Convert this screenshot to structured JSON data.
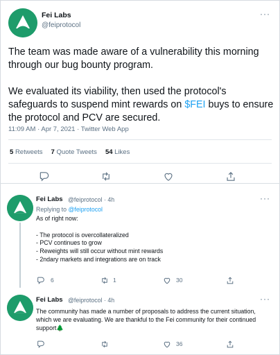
{
  "tweet": {
    "author_name": "Fei Labs",
    "author_handle": "@feiprotocol",
    "more_label": "···",
    "paragraph1": "The team was made aware of a vulnerability this morning through our bug bounty program.",
    "paragraph2_before": "We evaluated its viability, then used the protocol's safeguards to suspend mint rewards on ",
    "paragraph2_cashtag": "$FEI",
    "paragraph2_after": " buys to ensure the protocol and PCV are secured.",
    "timestamp": "11:09 AM · Apr 7, 2021 · Twitter Web App",
    "retweets_count": "5",
    "retweets_label": "Retweets",
    "quotes_count": "7",
    "quotes_label": "Quote Tweets",
    "likes_count": "54",
    "likes_label": "Likes",
    "actions": [
      "reply-icon",
      "retweet-icon",
      "like-icon",
      "share-icon"
    ]
  },
  "replies": [
    {
      "author_name": "Fei Labs",
      "meta": "@feiprotocol · 4h",
      "more_label": "···",
      "replying_to_label": "Replying to",
      "replying_to_handle": "@feiprotocol",
      "lines": [
        "As of right now:",
        "",
        "- The protocol is overcollateralized",
        "- PCV continues to grow",
        "- Reweights will still occur without mint rewards",
        "- 2ndary markets and integrations are on track"
      ],
      "reply_count": "6",
      "retweet_count": "1",
      "like_count": "30"
    },
    {
      "author_name": "Fei Labs",
      "meta": "@feiprotocol · 4h",
      "more_label": "···",
      "text": "The community has made a number of proposals to address the current situation, which we are evaluating. We are thankful to the Fei community for their continued support",
      "emoji": "🌲",
      "reply_count": "",
      "retweet_count": "",
      "like_count": "36"
    }
  ],
  "colors": {
    "accent": "#1da1f2",
    "avatar_bg": "#1e9c6b",
    "secondary_text": "#5b7083"
  }
}
